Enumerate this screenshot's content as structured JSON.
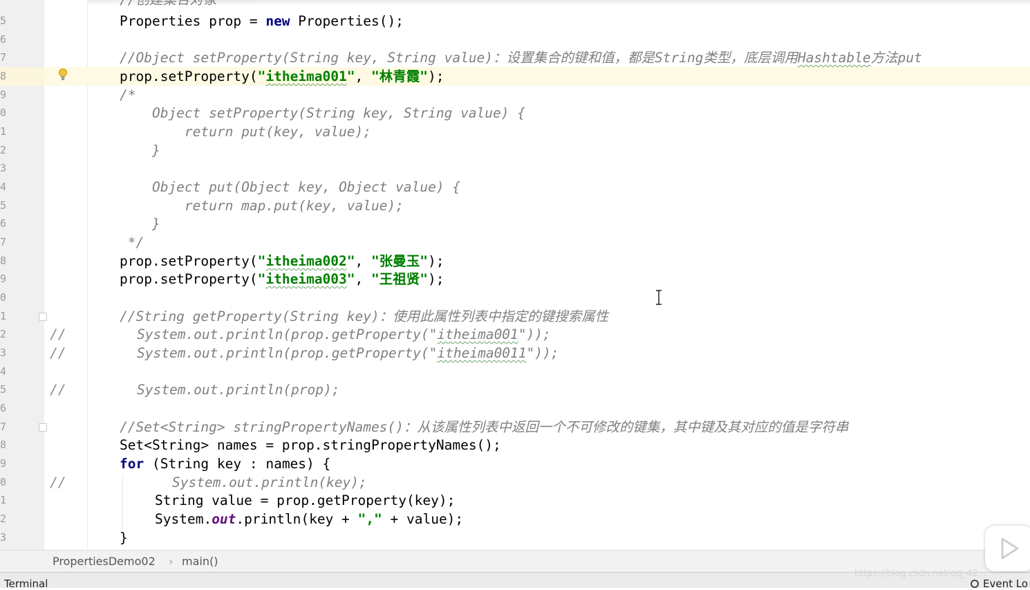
{
  "editor": {
    "line_number_tails": [
      "5",
      "6",
      "7",
      "8",
      "9",
      "0",
      "1",
      "2",
      "3",
      "4",
      "5",
      "6",
      "7",
      "8",
      "9",
      "0",
      "1",
      "2",
      "3",
      "4",
      "5",
      "6",
      "7",
      "8",
      "9",
      "0",
      "1",
      "2",
      "3"
    ],
    "partial_top_comment": "//创建集合对象",
    "lines": {
      "l1": {
        "a": "Properties prop = ",
        "kw": "new",
        "b": " Properties();"
      },
      "l2_comment": "//Object setProperty(String key, String value)：设置集合的键和值，都是String类型，底层调用",
      "l2_wavy": "Hashtable",
      "l2_tail": "方法put",
      "l3": {
        "a": "prop.setProperty(",
        "s1": "\"",
        "s1w": "itheima001",
        "s1e": "\"",
        "sep": ", ",
        "s2": "\"林青霞\"",
        "b": ");"
      },
      "l4": "/*",
      "l5": "    Object setProperty(String key, String value) {",
      "l6": "        return put(key, value);",
      "l7": "    }",
      "l8": "",
      "l9": "    Object put(Object key, Object value) {",
      "l10": "        return map.put(key, value);",
      "l11": "    }",
      "l12": " */",
      "l13": {
        "a": "prop.setProperty(",
        "s1": "\"",
        "s1w": "itheima002",
        "s1e": "\"",
        "sep": ", ",
        "s2": "\"张曼玉\"",
        "b": ");"
      },
      "l14": {
        "a": "prop.setProperty(",
        "s1": "\"",
        "s1w": "itheima003",
        "s1e": "\"",
        "sep": ", ",
        "s2": "\"王祖贤\"",
        "b": ");"
      },
      "l16_comment": "//String getProperty(String key)：使用此属性列表中指定的键搜索属性",
      "l17": {
        "pre": "System.out.println(prop.getProperty(\"",
        "w": "itheima001",
        "post": "\"));"
      },
      "l18": {
        "pre": "System.out.println(prop.getProperty(\"",
        "w": "itheima0011",
        "post": "\"));"
      },
      "l20": "System.out.println(prop);",
      "l22_comment": "//Set<String> stringPropertyNames()：从该属性列表中返回一个不可修改的键集，其中键及其对应的值是字符串",
      "l23": "Set<String> names = prop.stringPropertyNames();",
      "l24": {
        "kw": "for",
        "b": " (String key : names) {"
      },
      "l25": "System.out.println(key);",
      "l26": "String value = prop.getProperty(key);",
      "l27": {
        "a": "System.",
        "f": "out",
        "b": ".println(key + ",
        "s": "\",\"",
        "c": " + value);"
      },
      "l28": "}"
    },
    "line_comment_marker": "//",
    "colors": {
      "keyword": "#000080",
      "string": "#008000",
      "comment": "#808080",
      "highlight_line": "#fffae3"
    }
  },
  "breadcrumb": {
    "class_name": "PropertiesDemo02",
    "separator": "›",
    "method_name": "main()"
  },
  "status_bar": {
    "terminal_label": "Terminal",
    "event_log_label": "Event Lo"
  },
  "watermark": "https://blog.csdn.net/qq_42..."
}
